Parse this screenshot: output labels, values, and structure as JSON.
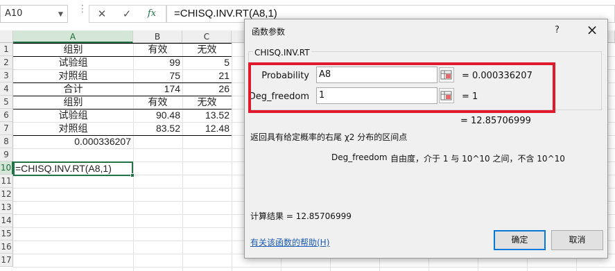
{
  "name_box": "A10",
  "formula": "=CHISQ.INV.RT(A8,1)",
  "columns": [
    "A",
    "B",
    "C"
  ],
  "rows": [
    "1",
    "2",
    "3",
    "4",
    "5",
    "6",
    "7",
    "8",
    "9",
    "10",
    "11",
    "12",
    "13",
    "14",
    "15",
    "16",
    "17",
    "18"
  ],
  "cells": {
    "r1": [
      "组别",
      "有效",
      "无效"
    ],
    "r2": [
      "试验组",
      "99",
      "5"
    ],
    "r3": [
      "对照组",
      "75",
      "21"
    ],
    "r4": [
      "合计",
      "174",
      "26"
    ],
    "r5": [
      "组别",
      "有效",
      "无效"
    ],
    "r6": [
      "试验组",
      "90.48",
      "13.52"
    ],
    "r7": [
      "对照组",
      "83.52",
      "12.48"
    ],
    "r8": [
      "0.000336207"
    ],
    "r10": [
      "=CHISQ.INV.RT(A8,1)"
    ]
  },
  "dialog": {
    "title": "函数参数",
    "help": "?",
    "close": "×",
    "function_name": "CHISQ.INV.RT",
    "args": [
      {
        "label": "Probability",
        "value": "A8",
        "eq": "=",
        "result": "0.000336207"
      },
      {
        "label": "Deg_freedom",
        "value": "1",
        "eq": "=",
        "result": "1"
      }
    ],
    "formula_result": "= 12.85706999",
    "description": "返回具有给定概率的右尾 χ2 分布的区间点",
    "arg_desc_name": "Deg_freedom",
    "arg_desc_text": "自由度，介于 1 与 10^10 之间，不含 10^10",
    "calc_result": "计算结果 = 12.85706999",
    "help_link": "有关该函数的帮助(H)",
    "ok": "确定",
    "cancel": "取消"
  },
  "colors": {
    "excel_green": "#217346",
    "highlight_red": "#e1192d",
    "link_blue": "#1a5bb5"
  }
}
